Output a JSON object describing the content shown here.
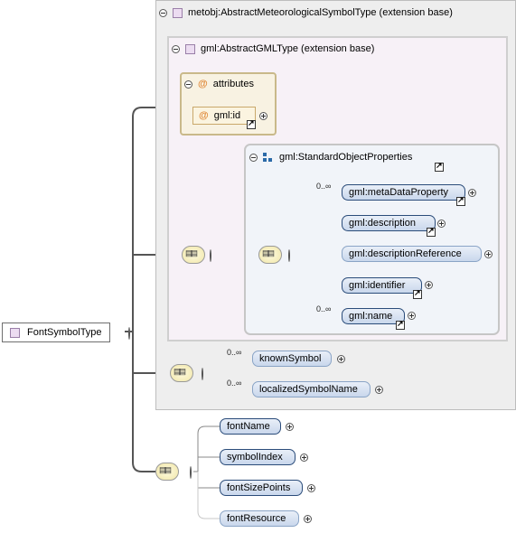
{
  "root": {
    "label": "FontSymbolType"
  },
  "extension_outer": {
    "label": "metobj:AbstractMeteorologicalSymbolType (extension base)"
  },
  "extension_inner": {
    "label": "gml:AbstractGMLType (extension base)"
  },
  "attributes": {
    "label": "attributes",
    "items": [
      {
        "label": "gml:id"
      }
    ]
  },
  "standard_object_properties": {
    "label": "gml:StandardObjectProperties",
    "elements": [
      {
        "label": "gml:metaDataProperty",
        "cardinality": "0..∞"
      },
      {
        "label": "gml:description",
        "cardinality": ""
      },
      {
        "label": "gml:descriptionReference",
        "cardinality": ""
      },
      {
        "label": "gml:identifier",
        "cardinality": ""
      },
      {
        "label": "gml:name",
        "cardinality": "0..∞"
      }
    ]
  },
  "meteo_sequence": {
    "elements": [
      {
        "label": "knownSymbol",
        "cardinality": "0..∞"
      },
      {
        "label": "localizedSymbolName",
        "cardinality": "0..∞"
      }
    ]
  },
  "font_sequence": {
    "elements": [
      {
        "label": "fontName",
        "cardinality": ""
      },
      {
        "label": "symbolIndex",
        "cardinality": ""
      },
      {
        "label": "fontSizePoints",
        "cardinality": ""
      },
      {
        "label": "fontResource",
        "cardinality": ""
      }
    ]
  }
}
